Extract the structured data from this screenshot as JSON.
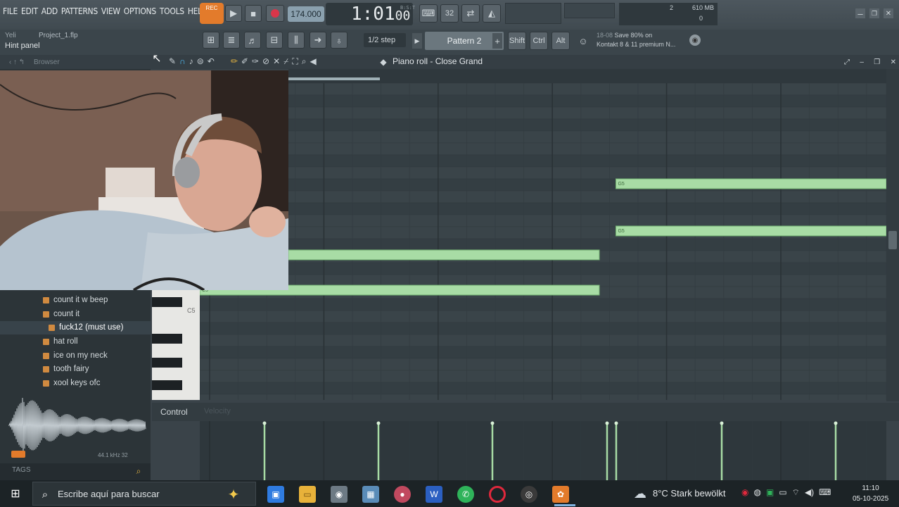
{
  "menu": [
    "FILE",
    "EDIT",
    "ADD",
    "PATTERNS",
    "VIEW",
    "OPTIONS",
    "TOOLS",
    "HELP"
  ],
  "transport": {
    "rec_badge": "REC",
    "tempo": "174.000",
    "time_main": "1:01",
    "time_sub": "00",
    "time_unit": "B:S:T"
  },
  "memory": {
    "count": "2",
    "mem": "610 MB",
    "poly": "0"
  },
  "hint": {
    "label": "Hint panel",
    "mini": "Yeli",
    "project": "Project_1.flp"
  },
  "step": "1/2 step",
  "pattern": "Pattern 2",
  "modifiers": [
    "Shift",
    "Ctrl",
    "Alt"
  ],
  "news": {
    "date": "18-08",
    "line1": "Save 80% on",
    "line2": "Kontakt 8 & 11 premium N..."
  },
  "browser_label": "Browser",
  "pianoroll": {
    "title": "Piano roll - Close Grand",
    "key_label": "C5"
  },
  "browser_items": [
    {
      "label": "count it w beep",
      "selected": false
    },
    {
      "label": "count it",
      "selected": false
    },
    {
      "label": "fuck12 (must use)",
      "selected": true
    },
    {
      "label": "hat roll",
      "selected": false
    },
    {
      "label": "ice on my neck",
      "selected": false
    },
    {
      "label": "tooth fairy",
      "selected": false
    },
    {
      "label": "xool keys ofc",
      "selected": false
    }
  ],
  "sample_info": "44.1 kHz 32",
  "tags_label": "TAGS",
  "control": {
    "label": "Control",
    "sub": "Velocity"
  },
  "notes": [
    {
      "label": "G5",
      "start": 0.606,
      "end": 1.0,
      "row": "upper"
    },
    {
      "label": "G5",
      "start": 0.606,
      "end": 1.0,
      "row": "mid"
    },
    {
      "label": "",
      "start": 0.129,
      "end": 0.582,
      "row": "low"
    },
    {
      "label": "C5",
      "start": 0.0,
      "end": 0.582,
      "row": "bottom"
    }
  ],
  "taskbar": {
    "search_placeholder": "Escribe aquí para buscar",
    "weather": "8°C  Stark bewölkt",
    "time": "11:10",
    "date": "05-10-2025"
  },
  "colors": {
    "note": "#a8dca5",
    "note_border": "#6fae6e",
    "grid_bg": "#3a4449",
    "accent_orange": "#e37b2b"
  }
}
